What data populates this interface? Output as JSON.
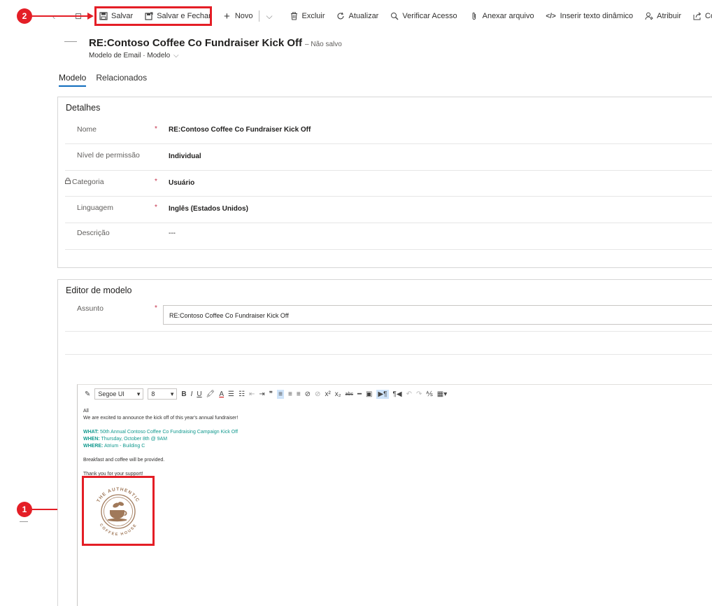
{
  "toolbar": {
    "save": "Salvar",
    "save_close": "Salvar e Fechar",
    "new": "Novo",
    "delete": "Excluir",
    "refresh": "Atualizar",
    "check_access": "Verificar Acesso",
    "attach": "Anexar arquivo",
    "insert_dynamic": "Inserir texto dinâmico",
    "assign": "Atribuir",
    "share": "Cor"
  },
  "callouts": {
    "one": "1",
    "two": "2"
  },
  "header": {
    "title": "RE:Contoso Coffee Co Fundraiser Kick Off",
    "unsaved": "– Não salvo",
    "subtitle": "Modelo de Email · Modelo"
  },
  "tabs": {
    "model": "Modelo",
    "related": "Relacionados"
  },
  "details": {
    "title": "Detalhes",
    "fields": [
      {
        "label": "Nome",
        "value": "RE:Contoso Coffee Co Fundraiser Kick Off",
        "required": "*"
      },
      {
        "label": "Nível de permissão",
        "value": "Individual",
        "required": ""
      },
      {
        "label": "Categoria",
        "value": "Usuário",
        "required": "*"
      },
      {
        "label": "Linguagem",
        "value": "Inglês (Estados Unidos)",
        "required": "*"
      },
      {
        "label": "Descrição",
        "value": "---",
        "required": ""
      }
    ]
  },
  "editor": {
    "title": "Editor de modelo",
    "subject_label": "Assunto",
    "subject_required": "*",
    "subject_value": "RE:Contoso Coffee Co Fundraiser Kick Off",
    "font": "Segoe UI",
    "size": "8",
    "body": {
      "greeting": "All",
      "intro": "We are excited to announce the kick off of this year's annual fundraiser!",
      "what_label": "WHAT:",
      "what": "50th Annual Contoso Coffee Co Fundraising Campaign Kick Off",
      "when_label": "WHEN:",
      "when": "Thursday, October 8th @ 9AM",
      "where_label": "WHERE:",
      "where": "Atrium - Building C",
      "breakfast": "Breakfast and coffee will be provided.",
      "thanks": "Thank you for your support!"
    },
    "logo": {
      "top": "THE AUTHENTIC",
      "bottom": "COFFEE HOUSE"
    }
  },
  "colors": {
    "accent": "#e41e26",
    "brand": "#0f6cbd",
    "green": "#11998e",
    "logo": "#a0795a"
  }
}
